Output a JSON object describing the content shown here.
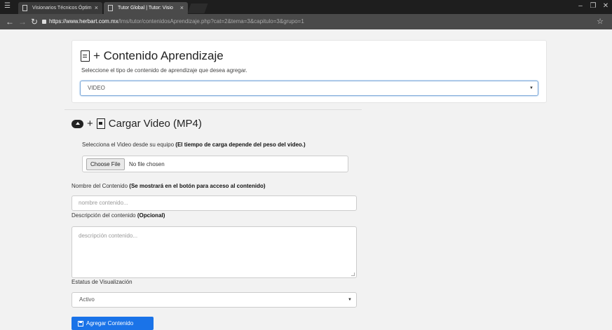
{
  "browser": {
    "tabs": [
      {
        "title": "Visionarios Técnicos Óptim",
        "active": false
      },
      {
        "title": "Tutor Global | Tutor: Visio",
        "active": true
      }
    ],
    "url_host": "https://www.herbart.com.mx",
    "url_path": "/lms/tutor/contenidosAprendizaje.php?cat=2&tema=3&capitulo=3&grupo=1",
    "close_glyph": "×",
    "window_controls": [
      "–",
      "❐",
      "✕"
    ]
  },
  "content_type": {
    "title": "+ Contenido Aprendizaje",
    "subtitle": "Seleccione el tipo de contenido de aprendizaje que desea agregar.",
    "selected": "VIDEO"
  },
  "upload": {
    "title_plus": "+",
    "title": "Cargar Video (MP4)",
    "file_label": "Selecciona el Video desde su equipo ",
    "file_label_bold": "(El tiempo de carga depende del peso del video.)",
    "choose_button": "Choose File",
    "file_status": "No file chosen"
  },
  "name_field": {
    "label": "Nombre del Contenido ",
    "label_bold": "(Se mostrará en el botón para acceso al contenido)",
    "placeholder": "nombre contenido..."
  },
  "description_field": {
    "label": "Descripción del contenido ",
    "label_bold": "(Opcional)",
    "placeholder": "descripción contenido..."
  },
  "status_field": {
    "label": "Estatus de Visualización",
    "selected": "Activo"
  },
  "submit": {
    "label": "Agregar Contenido"
  },
  "colors": {
    "primary": "#1a73e8",
    "focus_border": "#7aa7d8",
    "page_background": "#f2f2f2"
  }
}
